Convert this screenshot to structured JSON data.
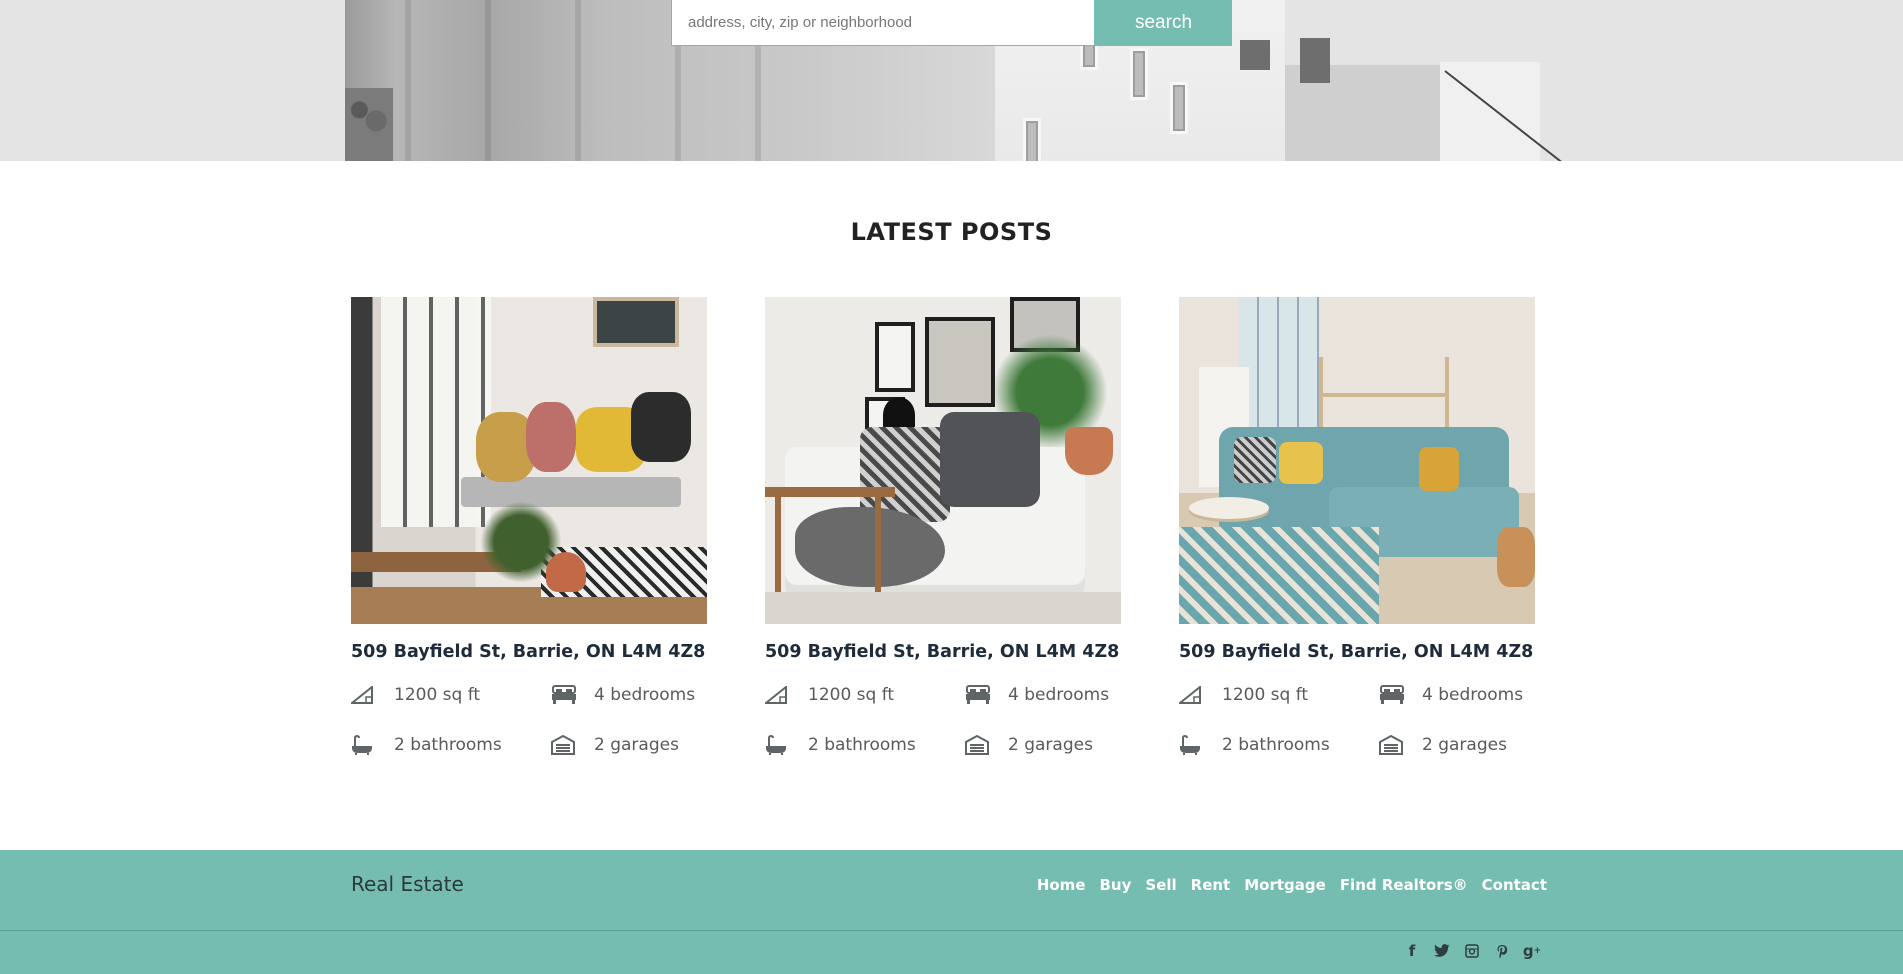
{
  "search": {
    "placeholder": "address, city, zip or neighborhood",
    "button_label": "search"
  },
  "section": {
    "title": "LATEST POSTS"
  },
  "posts": [
    {
      "address": "509 Bayfield St, Barrie, ON L4M 4Z8",
      "area": "1200 sq ft",
      "bedrooms": "4 bedrooms",
      "bathrooms": "2 bathrooms",
      "garages": "2 garages"
    },
    {
      "address": "509 Bayfield St, Barrie, ON L4M 4Z8",
      "area": "1200 sq ft",
      "bedrooms": "4 bedrooms",
      "bathrooms": "2 bathrooms",
      "garages": "2 garages"
    },
    {
      "address": "509 Bayfield St, Barrie, ON L4M 4Z8",
      "area": "1200 sq ft",
      "bedrooms": "4 bedrooms",
      "bathrooms": "2 bathrooms",
      "garages": "2 garages"
    }
  ],
  "footer": {
    "brand": "Real Estate",
    "nav": [
      "Home",
      "Buy",
      "Sell",
      "Rent",
      "Mortgage",
      "Find Realtors®",
      "Contact"
    ],
    "social_icons": [
      "facebook-icon",
      "twitter-icon",
      "instagram-icon",
      "pinterest-icon",
      "google-plus-icon"
    ]
  },
  "colors": {
    "accent": "#75bdb1",
    "title_text": "#1d2b3a",
    "feature_text": "#5a5a5a"
  }
}
